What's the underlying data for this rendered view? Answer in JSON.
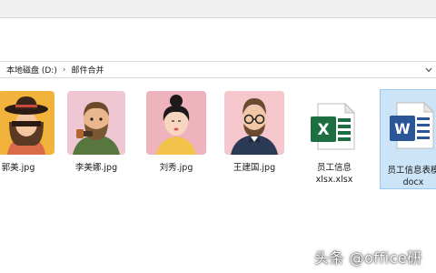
{
  "address": {
    "drive": "本地磁盘 (D:)",
    "folder": "邮件合并"
  },
  "files": [
    {
      "name": "郭美.jpg",
      "icon": "avatar-woman-hat-icon"
    },
    {
      "name": "李美娜.jpg",
      "icon": "avatar-man-beard-pipe-icon"
    },
    {
      "name": "刘秀.jpg",
      "icon": "avatar-woman-bun-icon"
    },
    {
      "name": "王建国.jpg",
      "icon": "avatar-man-glasses-bowtie-icon"
    },
    {
      "name": "员工信息",
      "name2": "xlsx.xlsx",
      "icon": "excel-file-icon"
    },
    {
      "name": "员工信息表模",
      "name2": "docx",
      "icon": "word-file-icon",
      "selected": true
    }
  ],
  "watermark": "头条 @office研",
  "colors": {
    "selection": "#cce4f7",
    "excel": "#1d6f42",
    "word": "#2b579a"
  }
}
